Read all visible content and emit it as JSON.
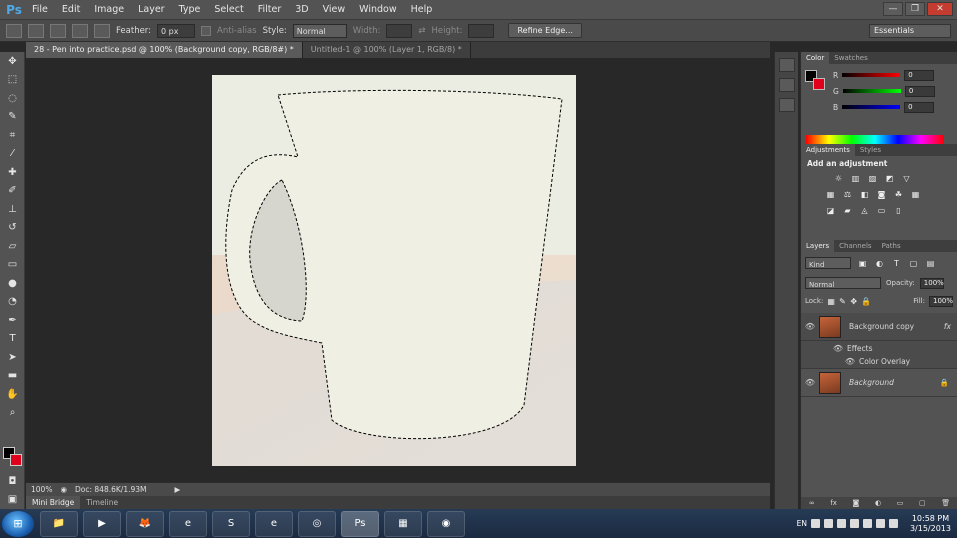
{
  "menubar": {
    "logo": "Ps",
    "items": [
      "File",
      "Edit",
      "Image",
      "Layer",
      "Type",
      "Select",
      "Filter",
      "3D",
      "View",
      "Window",
      "Help"
    ],
    "window_controls": [
      "—",
      "❐",
      "✕"
    ]
  },
  "options_bar": {
    "feather_label": "Feather:",
    "feather_value": "0 px",
    "antialias_label": "Anti-alias",
    "style_label": "Style:",
    "style_value": "Normal",
    "width_label": "Width:",
    "height_label": "Height:",
    "refine_edge_label": "Refine Edge...",
    "workspace_value": "Essentials"
  },
  "document_tabs": [
    {
      "label": "28 - Pen into practice.psd @ 100% (Background copy, RGB/8#) *",
      "active": true
    },
    {
      "label": "Untitled-1 @ 100% (Layer 1, RGB/8) *",
      "active": false
    }
  ],
  "status_bar": {
    "zoom": "100%",
    "doc_info": "Doc: 848.6K/1.93M"
  },
  "bottom_tabs": [
    "Mini Bridge",
    "Timeline"
  ],
  "color_panel": {
    "tabs": [
      "Color",
      "Swatches"
    ],
    "channels": [
      {
        "label": "R",
        "value": "0",
        "color": "#d62020"
      },
      {
        "label": "G",
        "value": "0",
        "color": "#2ca02c"
      },
      {
        "label": "B",
        "value": "0",
        "color": "#1f3fd6"
      }
    ]
  },
  "adjustments_panel": {
    "tabs": [
      "Adjustments",
      "Styles"
    ],
    "heading": "Add an adjustment"
  },
  "layers_panel": {
    "tabs": [
      "Layers",
      "Channels",
      "Paths"
    ],
    "filter_kind": "Kind",
    "blend_mode": "Normal",
    "opacity_label": "Opacity:",
    "opacity_value": "100%",
    "lock_label": "Lock:",
    "fill_label": "Fill:",
    "fill_value": "100%",
    "layers": [
      {
        "name": "Background copy",
        "fx": "fx"
      },
      {
        "name": "Effects"
      },
      {
        "name": "Color Overlay"
      },
      {
        "name": "Background"
      }
    ]
  },
  "taskbar": {
    "start": "⊞",
    "apps": [
      "📁",
      "▶",
      "🦊",
      "e",
      "S",
      "e",
      "◎",
      "Ps",
      "▦",
      "◉"
    ],
    "language": "EN",
    "time": "10:58 PM",
    "date": "3/15/2013"
  },
  "colors": {
    "canvas_fill": "#eeeedf",
    "foreground": "#000000",
    "background": "#e0001b"
  }
}
